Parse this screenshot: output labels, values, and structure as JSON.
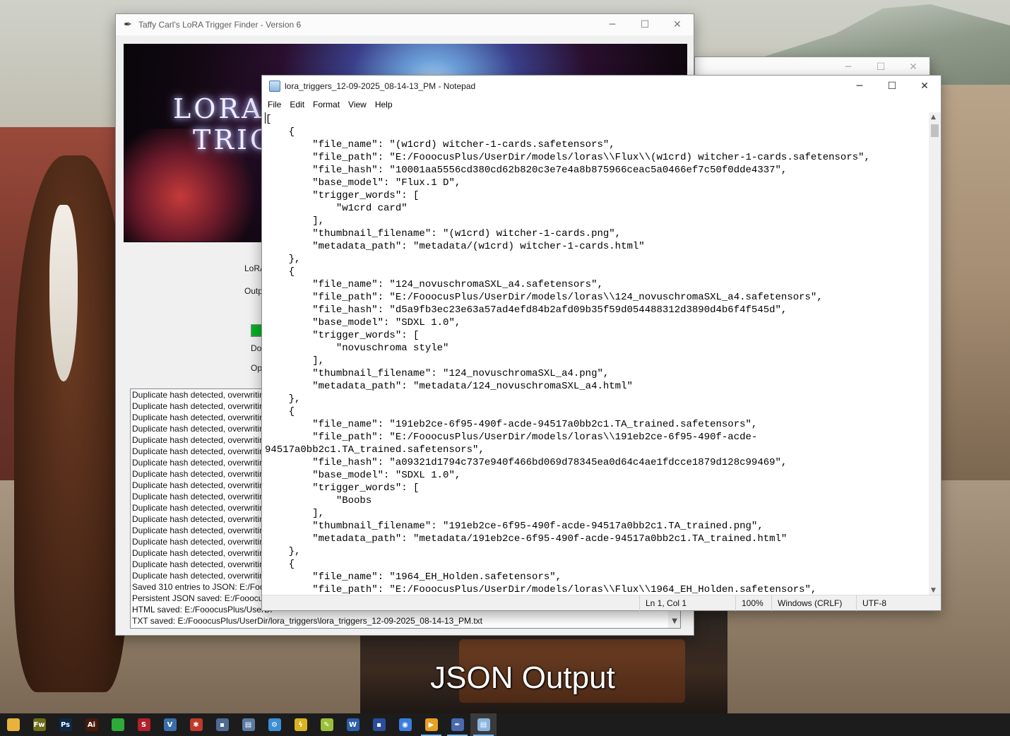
{
  "caption": "JSON Output",
  "app_window": {
    "title": "Taffy Carl's LoRA Trigger Finder - Version 6",
    "banner_text_line1": "LORA",
    "banner_text_line2": "TRIGG",
    "label_lora": "LoRA",
    "label_output": "Outp",
    "label_do": "Do",
    "label_op": "Op",
    "log_lines": [
      "Duplicate hash detected, overwritin",
      "Duplicate hash detected, overwritin",
      "Duplicate hash detected, overwritin",
      "Duplicate hash detected, overwritin",
      "Duplicate hash detected, overwritin",
      "Duplicate hash detected, overwritin",
      "Duplicate hash detected, overwritin",
      "Duplicate hash detected, overwritin",
      "Duplicate hash detected, overwritin",
      "Duplicate hash detected, overwritin",
      "Duplicate hash detected, overwritin",
      "Duplicate hash detected, overwritin",
      "Duplicate hash detected, overwritin",
      "Duplicate hash detected, overwritin",
      "Duplicate hash detected, overwritin",
      "Duplicate hash detected, overwritin",
      "Duplicate hash detected, overwritin",
      "Saved 310 entries to JSON: E:/Foooc",
      "Persistent JSON saved: E:/FooocusP",
      "HTML saved: E:/FooocusPlus/UserDi",
      "TXT saved: E:/FooocusPlus/UserDir/lora_triggers\\lora_triggers_12-09-2025_08-14-13_PM.txt"
    ]
  },
  "notepad": {
    "title": "lora_triggers_12-09-2025_08-14-13_PM - Notepad",
    "menu": [
      "File",
      "Edit",
      "Format",
      "View",
      "Help"
    ],
    "lines": [
      "[",
      "    {",
      "        \"file_name\": \"(w1crd) witcher-1-cards.safetensors\",",
      "        \"file_path\": \"E:/FooocusPlus/UserDir/models/loras\\\\Flux\\\\(w1crd) witcher-1-cards.safetensors\",",
      "        \"file_hash\": \"10001aa5556cd380cd62b820c3e7e4a8b875966ceac5a0466ef7c50f0dde4337\",",
      "        \"base_model\": \"Flux.1 D\",",
      "        \"trigger_words\": [",
      "            \"w1crd card\"",
      "        ],",
      "        \"thumbnail_filename\": \"(w1crd) witcher-1-cards.png\",",
      "        \"metadata_path\": \"metadata/(w1crd) witcher-1-cards.html\"",
      "    },",
      "    {",
      "        \"file_name\": \"124_novuschromaSXL_a4.safetensors\",",
      "        \"file_path\": \"E:/FooocusPlus/UserDir/models/loras\\\\124_novuschromaSXL_a4.safetensors\",",
      "        \"file_hash\": \"d5a9fb3ec23e63a57ad4efd84b2afd09b35f59d054488312d3890d4b6f4f545d\",",
      "        \"base_model\": \"SDXL 1.0\",",
      "        \"trigger_words\": [",
      "            \"novuschroma style\"",
      "        ],",
      "        \"thumbnail_filename\": \"124_novuschromaSXL_a4.png\",",
      "        \"metadata_path\": \"metadata/124_novuschromaSXL_a4.html\"",
      "    },",
      "    {",
      "        \"file_name\": \"191eb2ce-6f95-490f-acde-94517a0bb2c1.TA_trained.safetensors\",",
      "        \"file_path\": \"E:/FooocusPlus/UserDir/models/loras\\\\191eb2ce-6f95-490f-acde-",
      "94517a0bb2c1.TA_trained.safetensors\",",
      "        \"file_hash\": \"a09321d1794c737e940f466bd069d78345ea0d64c4ae1fdcce1879d128c99469\",",
      "        \"base_model\": \"SDXL 1.0\",",
      "        \"trigger_words\": [",
      "            \"Boobs",
      "        ],",
      "        \"thumbnail_filename\": \"191eb2ce-6f95-490f-acde-94517a0bb2c1.TA_trained.png\",",
      "        \"metadata_path\": \"metadata/191eb2ce-6f95-490f-acde-94517a0bb2c1.TA_trained.html\"",
      "    },",
      "    {",
      "        \"file_name\": \"1964_EH_Holden.safetensors\",",
      "        \"file_path\": \"E:/FooocusPlus/UserDir/models/loras\\\\Flux\\\\1964_EH_Holden.safetensors\","
    ],
    "status": {
      "position": "Ln 1, Col 1",
      "zoom": "100%",
      "line_ending": "Windows (CRLF)",
      "encoding": "UTF-8"
    }
  },
  "taskbar": [
    {
      "icon": "file-explorer-icon",
      "glyph": "",
      "color": "#e8b33a"
    },
    {
      "icon": "fireworks-icon",
      "glyph": "Fw",
      "color": "#6d6d1a"
    },
    {
      "icon": "photoshop-icon",
      "glyph": "Ps",
      "color": "#0b2a4a"
    },
    {
      "icon": "illustrator-icon",
      "glyph": "Ai",
      "color": "#4a1a0a"
    },
    {
      "icon": "app-green-icon",
      "glyph": "",
      "color": "#2eaa3a"
    },
    {
      "icon": "app-s-icon",
      "glyph": "S",
      "color": "#b3202a"
    },
    {
      "icon": "visual-studio-icon",
      "glyph": "V",
      "color": "#3a6ea8"
    },
    {
      "icon": "bug-icon",
      "glyph": "✱",
      "color": "#c0392b"
    },
    {
      "icon": "save-icon",
      "glyph": "▪",
      "color": "#506a90"
    },
    {
      "icon": "film-icon",
      "glyph": "▤",
      "color": "#5a7aa0"
    },
    {
      "icon": "settings-icon",
      "glyph": "⚙",
      "color": "#3a8fd6"
    },
    {
      "icon": "lightning-icon",
      "glyph": "ϟ",
      "color": "#d9b420"
    },
    {
      "icon": "notes-icon",
      "glyph": "✎",
      "color": "#9cbf3a"
    },
    {
      "icon": "word-icon",
      "glyph": "W",
      "color": "#2b5faa"
    },
    {
      "icon": "floppy-icon",
      "glyph": "▪",
      "color": "#2a4f9a"
    },
    {
      "icon": "chrome-icon",
      "glyph": "◉",
      "color": "#3b7ddd"
    },
    {
      "icon": "media-player-icon",
      "glyph": "▶",
      "color": "#e8a020"
    },
    {
      "icon": "feather-icon",
      "glyph": "✒",
      "color": "#4a6ab0"
    },
    {
      "icon": "notepad-icon",
      "glyph": "▤",
      "color": "#8ab5de"
    }
  ]
}
